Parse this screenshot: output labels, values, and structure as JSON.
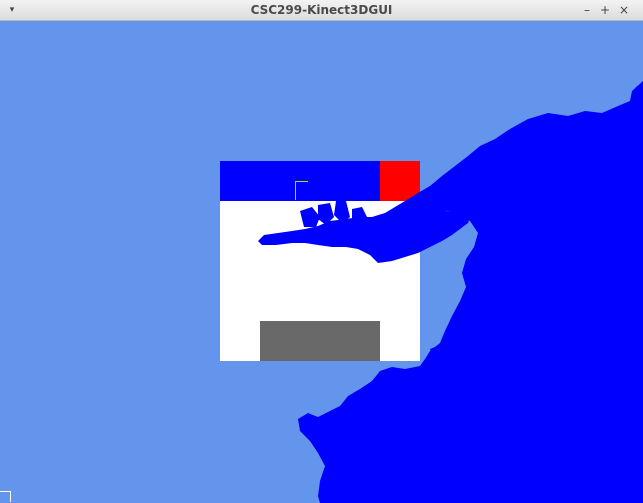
{
  "window": {
    "title": "CSC299-Kinect3DGUI",
    "menu_glyph": "▾",
    "minimize_glyph": "–",
    "maximize_glyph": "+",
    "close_glyph": "×"
  },
  "colors": {
    "background": "#6495ED",
    "depth_blob": "#0000FF",
    "panel_bar": "#0000FF",
    "panel_close": "#FF0000",
    "panel_body": "#FFFFFF",
    "panel_button": "#696969",
    "cursor": "#7CFC00"
  },
  "icons": {
    "menu": "chevron-down-icon",
    "minimize": "minimize-icon",
    "maximize": "maximize-icon",
    "close": "close-icon"
  }
}
